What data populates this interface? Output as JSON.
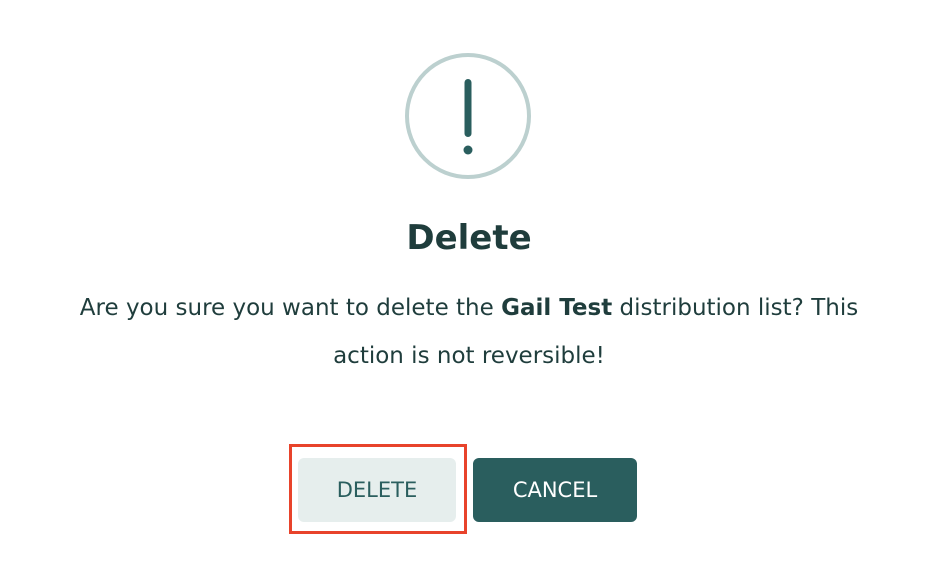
{
  "dialog": {
    "icon": "exclamation-circle-icon",
    "title": "Delete",
    "message_prefix": "Are you sure you want to delete the ",
    "list_name": "Gail Test",
    "message_suffix": " distribution list? This action is not reversible!",
    "buttons": {
      "delete_label": "DELETE",
      "cancel_label": "CANCEL"
    }
  },
  "colors": {
    "primary": "#2a5e5e",
    "icon_ring": "#bcd0cf",
    "secondary_bg": "#e6eeed",
    "highlight": "#e8432b",
    "text": "#1f3d3c"
  }
}
